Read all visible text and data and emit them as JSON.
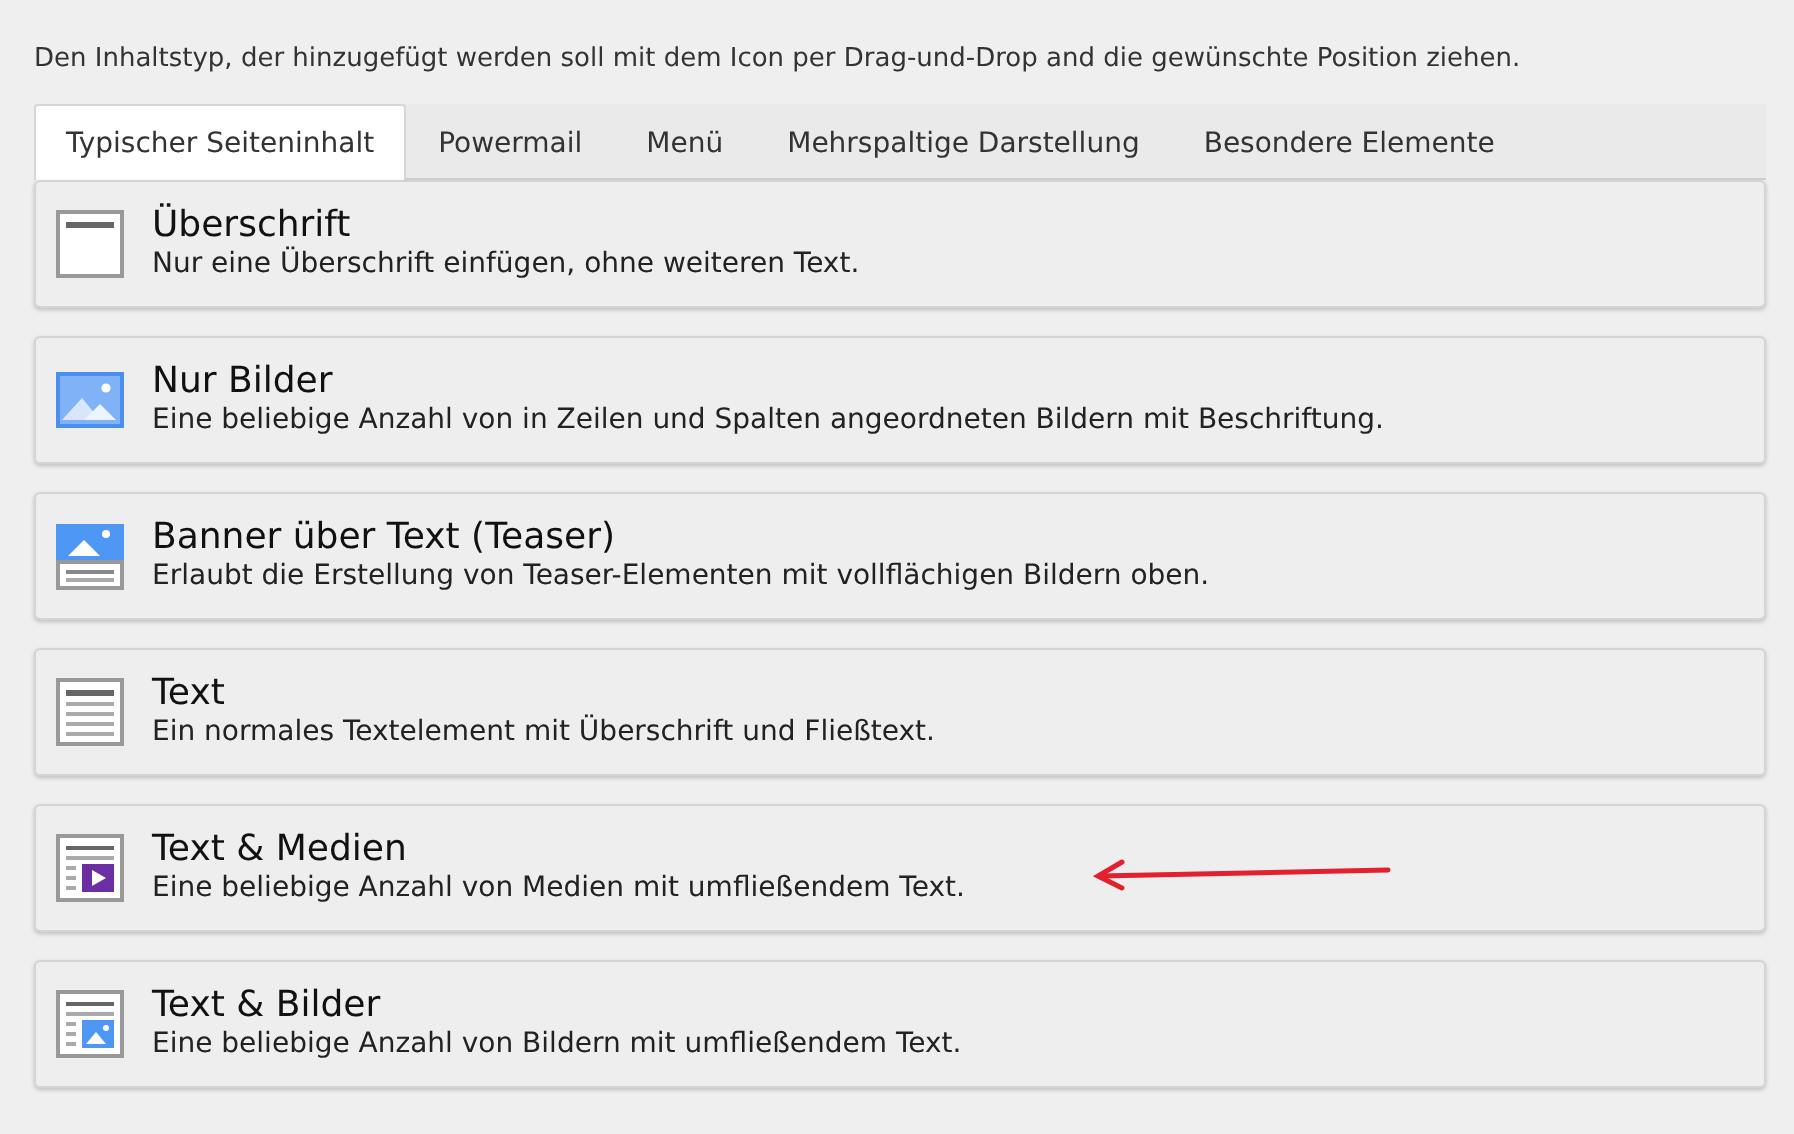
{
  "instruction": "Den Inhaltstyp, der hinzugefügt werden soll mit dem Icon per Drag-und-Drop and die gewünschte Position ziehen.",
  "tabs": [
    {
      "label": "Typischer Seiteninhalt",
      "selected": true
    },
    {
      "label": "Powermail",
      "selected": false
    },
    {
      "label": "Menü",
      "selected": false
    },
    {
      "label": "Mehrspaltige Darstellung",
      "selected": false
    },
    {
      "label": "Besondere Elemente",
      "selected": false
    }
  ],
  "elements": [
    {
      "kind": "header",
      "title": "Überschrift",
      "description": "Nur eine Überschrift einfügen, ohne weiteren Text."
    },
    {
      "kind": "images",
      "title": "Nur Bilder",
      "description": "Eine beliebige Anzahl von in Zeilen und Spalten angeordneten Bildern mit Beschriftung."
    },
    {
      "kind": "banner",
      "title": "Banner über Text (Teaser)",
      "description": "Erlaubt die Erstellung von Teaser-Elementen mit vollflächigen Bildern oben."
    },
    {
      "kind": "text",
      "title": "Text",
      "description": "Ein normales Textelement mit Überschrift und Fließtext."
    },
    {
      "kind": "textmedia",
      "title": "Text & Medien",
      "description": "Eine beliebige Anzahl von Medien mit umfließendem Text."
    },
    {
      "kind": "textpic",
      "title": "Text & Bilder",
      "description": "Eine beliebige Anzahl von Bildern mit umfließendem Text."
    }
  ]
}
